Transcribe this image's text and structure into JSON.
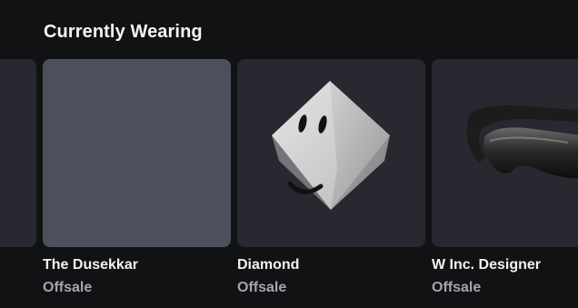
{
  "section": {
    "title": "Currently Wearing"
  },
  "items": [
    {
      "name": "",
      "price": ""
    },
    {
      "name": "The Dusekkar",
      "price": "Offsale"
    },
    {
      "name": "Diamond",
      "price": "Offsale"
    },
    {
      "name": "W Inc. Designer",
      "price": "Offsale"
    }
  ],
  "colors": {
    "background": "#111214",
    "card": "#272830",
    "card_hover": "#4b505c",
    "secondary_text": "#a4a6ad"
  },
  "icons": [
    "diamond-head-icon",
    "sunglasses-icon"
  ]
}
